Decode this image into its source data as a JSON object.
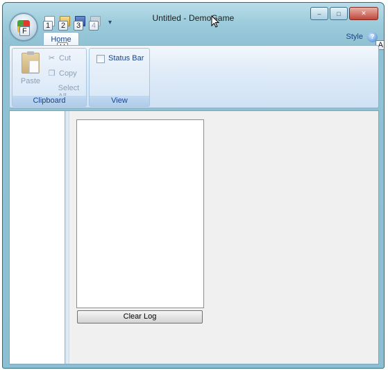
{
  "window": {
    "title": "Untitled - DemoGame",
    "controls": {
      "minimize": "‒",
      "maximize": "□",
      "close": "✕"
    }
  },
  "app_button": {
    "keytip": "F"
  },
  "quick_access": {
    "items": [
      {
        "icon": "new-document-icon",
        "keytip": "1"
      },
      {
        "icon": "open-folder-icon",
        "keytip": "2"
      },
      {
        "icon": "save-icon",
        "keytip": "3"
      },
      {
        "icon": "print-icon",
        "keytip": "4"
      }
    ],
    "more": "▾"
  },
  "tabs": [
    {
      "label": "Home",
      "keytip": "H",
      "active": true
    }
  ],
  "right_menu": {
    "style_label": "Style",
    "help_keytip": "A",
    "help_glyph": "?"
  },
  "ribbon": {
    "clipboard": {
      "label": "Clipboard",
      "paste": "Paste",
      "cut": "Cut",
      "copy": "Copy",
      "select_all": "Select All"
    },
    "view": {
      "label": "View",
      "status_bar": "Status Bar",
      "status_bar_checked": false
    }
  },
  "main": {
    "clear_log_label": "Clear Log"
  },
  "colors": {
    "ribbon_text": "#15428b",
    "frame": "#8bbfd1"
  }
}
